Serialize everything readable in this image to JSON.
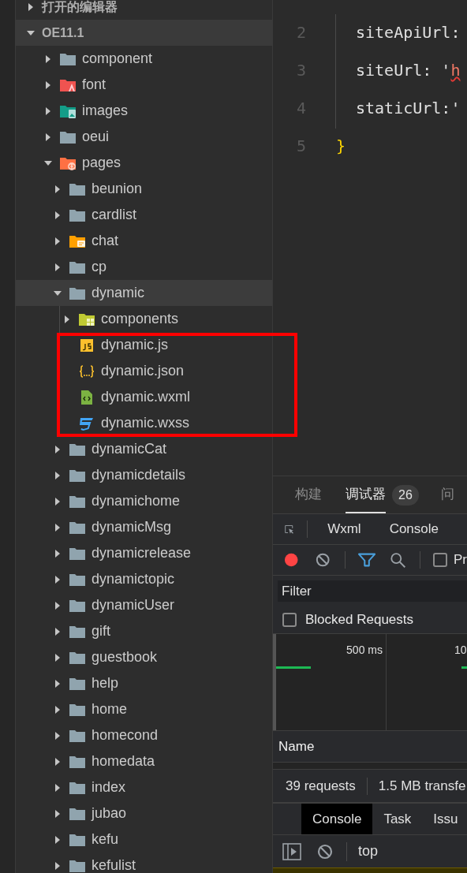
{
  "explorer": {
    "sections": [
      {
        "label": "打开的编辑器",
        "expanded": false,
        "selected": false
      },
      {
        "label": "OE11.1",
        "expanded": true,
        "selected": true,
        "children": [
          {
            "label": "component",
            "kind": "folder",
            "expanded": false,
            "selected": false
          },
          {
            "label": "font",
            "kind": "font_folder",
            "expanded": false,
            "selected": false
          },
          {
            "label": "images",
            "kind": "image_folder",
            "expanded": false,
            "selected": false
          },
          {
            "label": "oeui",
            "kind": "folder",
            "expanded": false,
            "selected": false
          },
          {
            "label": "pages",
            "kind": "page_folder",
            "expanded": true,
            "selected": false,
            "children": [
              {
                "label": "beunion",
                "kind": "folder",
                "expanded": false,
                "selected": false
              },
              {
                "label": "cardlist",
                "kind": "folder",
                "expanded": false,
                "selected": false
              },
              {
                "label": "chat",
                "kind": "chat_folder",
                "expanded": false,
                "selected": false
              },
              {
                "label": "cp",
                "kind": "folder",
                "expanded": false,
                "selected": false
              },
              {
                "label": "dynamic",
                "kind": "folder",
                "expanded": true,
                "selected": true,
                "children": [
                  {
                    "label": "components",
                    "kind": "component_folder",
                    "expanded": false,
                    "selected": false,
                    "boxed": false
                  },
                  {
                    "label": "dynamic.js",
                    "kind": "js_file",
                    "selected": false,
                    "boxed": true
                  },
                  {
                    "label": "dynamic.json",
                    "kind": "json_file",
                    "selected": false,
                    "boxed": true
                  },
                  {
                    "label": "dynamic.wxml",
                    "kind": "wxml_file",
                    "selected": false,
                    "boxed": true
                  },
                  {
                    "label": "dynamic.wxss",
                    "kind": "wxss_file",
                    "selected": false,
                    "boxed": true
                  }
                ]
              },
              {
                "label": "dynamicCat",
                "kind": "folder",
                "expanded": false,
                "selected": false
              },
              {
                "label": "dynamicdetails",
                "kind": "folder",
                "expanded": false,
                "selected": false
              },
              {
                "label": "dynamichome",
                "kind": "folder",
                "expanded": false,
                "selected": false
              },
              {
                "label": "dynamicMsg",
                "kind": "folder",
                "expanded": false,
                "selected": false
              },
              {
                "label": "dynamicrelease",
                "kind": "folder",
                "expanded": false,
                "selected": false
              },
              {
                "label": "dynamictopic",
                "kind": "folder",
                "expanded": false,
                "selected": false
              },
              {
                "label": "dynamicUser",
                "kind": "folder",
                "expanded": false,
                "selected": false
              },
              {
                "label": "gift",
                "kind": "folder",
                "expanded": false,
                "selected": false
              },
              {
                "label": "guestbook",
                "kind": "folder",
                "expanded": false,
                "selected": false
              },
              {
                "label": "help",
                "kind": "folder",
                "expanded": false,
                "selected": false
              },
              {
                "label": "home",
                "kind": "folder",
                "expanded": false,
                "selected": false
              },
              {
                "label": "homecond",
                "kind": "folder",
                "expanded": false,
                "selected": false
              },
              {
                "label": "homedata",
                "kind": "folder",
                "expanded": false,
                "selected": false
              },
              {
                "label": "index",
                "kind": "folder",
                "expanded": false,
                "selected": false
              },
              {
                "label": "jubao",
                "kind": "folder",
                "expanded": false,
                "selected": false
              },
              {
                "label": "kefu",
                "kind": "folder",
                "expanded": false,
                "selected": false
              },
              {
                "label": "kefulist",
                "kind": "folder",
                "expanded": false,
                "selected": false
              }
            ]
          }
        ]
      }
    ]
  },
  "editor": {
    "lines": [
      {
        "number": "2",
        "tokens": [
          {
            "text": "siteApiUrl:",
            "kind": "plain"
          }
        ]
      },
      {
        "number": "3",
        "tokens": [
          {
            "text": "siteUrl: '",
            "kind": "plain"
          },
          {
            "text": "h",
            "kind": "string"
          }
        ]
      },
      {
        "number": "4",
        "tokens": [
          {
            "text": "staticUrl:'",
            "kind": "plain"
          }
        ]
      },
      {
        "number": "5",
        "tokens": [
          {
            "text": "}",
            "kind": "brace"
          }
        ]
      }
    ]
  },
  "devtools": {
    "tabs": [
      {
        "label": "构建",
        "selected": false
      },
      {
        "label": "调试器",
        "selected": true,
        "badge": "26"
      },
      {
        "label": "问",
        "selected": false
      }
    ],
    "panels": [
      {
        "label": "Wxml"
      },
      {
        "label": "Console"
      }
    ],
    "toolbar": {
      "recording": true,
      "checkbox_label": "Pr",
      "checked": false
    },
    "filter": {
      "placeholder": "Filter"
    },
    "blocked_requests": {
      "label": "Blocked Requests",
      "checked": false
    },
    "timeline": {
      "ticks": [
        "500 ms",
        "10"
      ]
    },
    "table": {
      "columns": [
        "Name"
      ]
    },
    "summary": [
      "39 requests",
      "1.5 MB transfe"
    ],
    "drawer_tabs": [
      {
        "label": "Console",
        "selected": true
      },
      {
        "label": "Task",
        "selected": false
      },
      {
        "label": "Issu",
        "selected": false
      }
    ],
    "context": "top"
  }
}
